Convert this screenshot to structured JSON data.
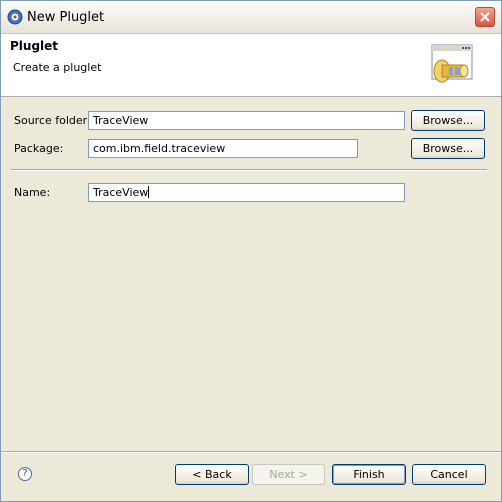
{
  "window": {
    "title": "New Pluglet",
    "icon": "eclipse-wizard-icon",
    "close_icon": "close-icon"
  },
  "banner": {
    "title": "Pluglet",
    "description": "Create a pluglet",
    "image": "pluglet-wizard-banner-icon"
  },
  "form": {
    "source_folder": {
      "label": "Source folder:",
      "value": "TraceView",
      "browse_label": "Browse..."
    },
    "package": {
      "label": "Package:",
      "value": "com.ibm.field.traceview",
      "browse_label": "Browse..."
    },
    "name": {
      "label": "Name:",
      "value": "TraceView"
    }
  },
  "footer": {
    "help_icon": "help-icon",
    "back_label": "< Back",
    "next_label": "Next >",
    "finish_label": "Finish",
    "cancel_label": "Cancel"
  },
  "colors": {
    "dialog_background": "#ece9d8",
    "banner_background": "#ffffff",
    "field_border": "#7f9db9",
    "button_border": "#003c74",
    "close_button": "#d8553e"
  }
}
